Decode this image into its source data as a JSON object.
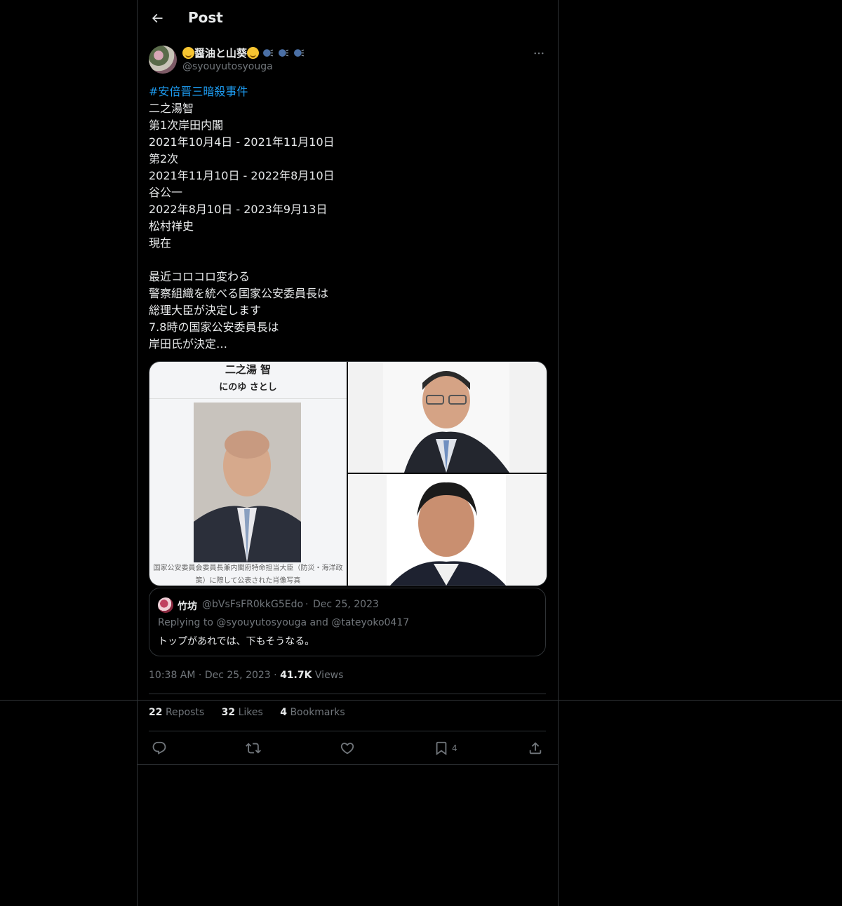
{
  "header": {
    "title": "Post"
  },
  "author": {
    "display_name": "醤油と山葵",
    "handle": "@syouyutosyouga"
  },
  "tweet": {
    "hashtag": "#安倍晋三暗殺事件",
    "lines": [
      "二之湯智",
      "第1次岸田内閣",
      "2021年10月4日 - 2021年11月10日",
      "第2次",
      "2021年11月10日 - 2022年8月10日",
      "谷公一",
      "2022年8月10日 - 2023年9月13日",
      "松村祥史",
      "現在",
      "",
      "最近コロコロ変わる",
      "警察組織を統べる国家公安委員長は",
      "総理大臣が決定します",
      "7.8時の国家公安委員長は",
      "岸田氏が決定…"
    ]
  },
  "media": {
    "image1": {
      "title": "二之湯 智",
      "reading": "にのゆ さとし",
      "caption": "国家公安委員会委員長兼内閣府特命担当大臣（防災・海洋政策）に際して公表された肖像写真"
    }
  },
  "quote": {
    "name": "竹坊",
    "handle": "@bVsFsFR0kkG5Edo",
    "dot": "·",
    "date": "Dec 25, 2023",
    "replying": "Replying to @syouyutosyouga and @tateyoko0417",
    "text": "トップがあれでは、下もそうなる。"
  },
  "meta": {
    "time": "10:38 AM",
    "date": "Dec 25, 2023",
    "views_count": "41.7K",
    "views_label": "Views"
  },
  "stats": {
    "reposts_count": "22",
    "reposts_label": "Reposts",
    "likes_count": "32",
    "likes_label": "Likes",
    "bookmarks_count": "4",
    "bookmarks_label": "Bookmarks"
  },
  "actions": {
    "bookmark_count": "4"
  },
  "colors": {
    "background": "#000000",
    "border": "#2f3336",
    "muted": "#71767b",
    "text": "#e7e9ea",
    "link": "#1d9bf0"
  },
  "icons": [
    "back-arrow-icon",
    "more-icon",
    "reply-icon",
    "repost-icon",
    "like-icon",
    "bookmark-icon",
    "share-icon"
  ]
}
